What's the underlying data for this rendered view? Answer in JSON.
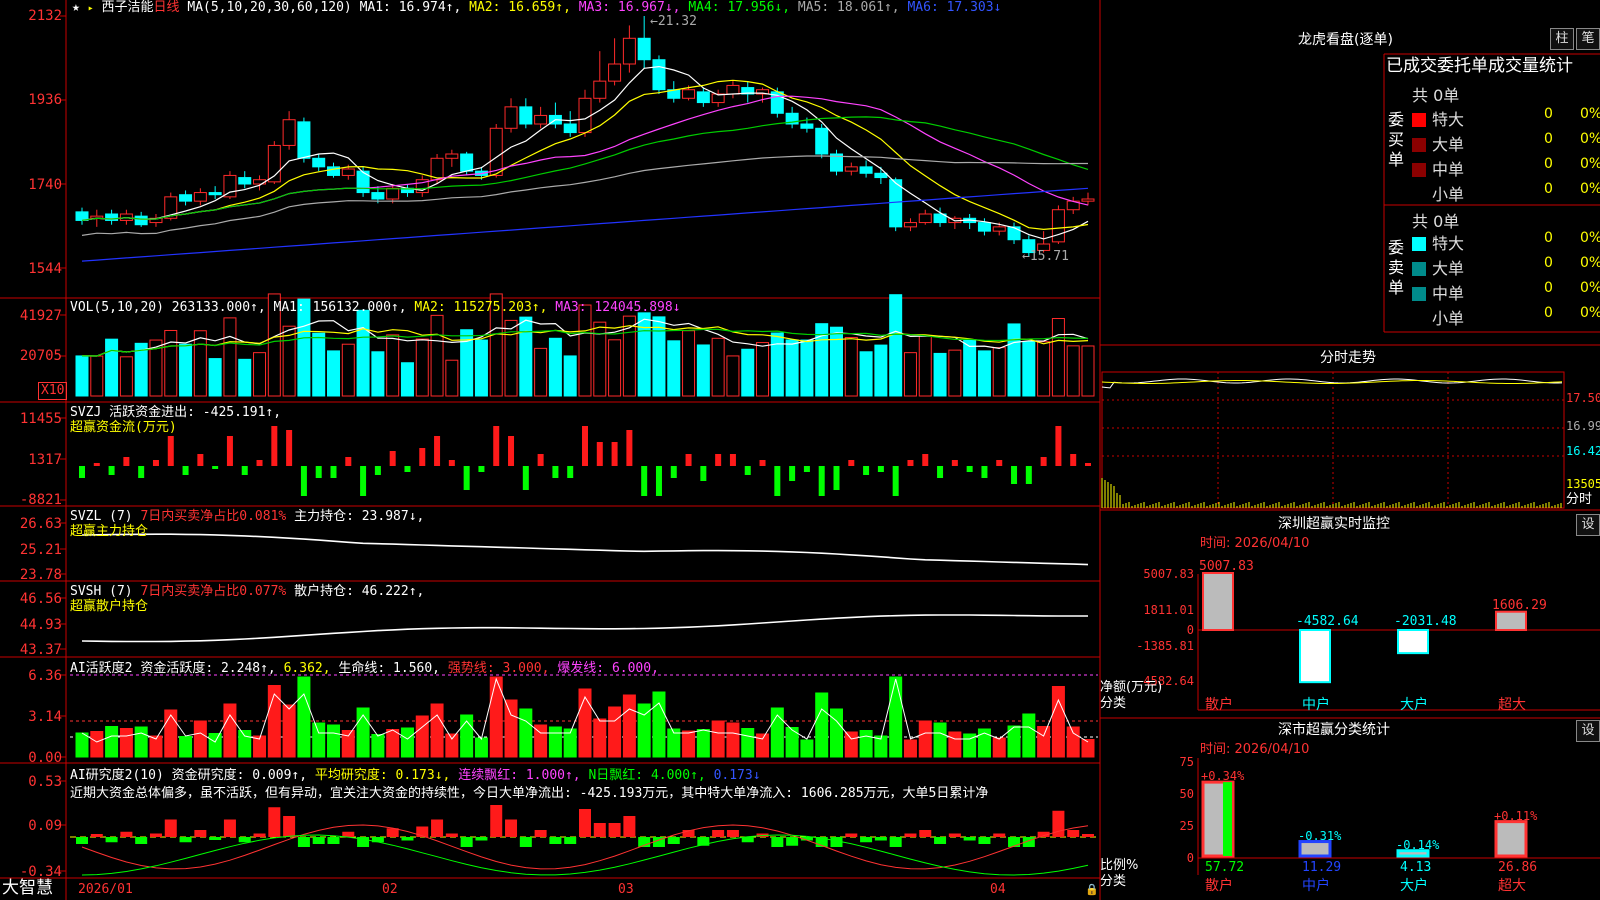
{
  "colors": {
    "up": "#ff2a2a",
    "down": "#00ffff",
    "grid": "#c80000",
    "ma1": "#ffffff",
    "ma2": "#ffff00",
    "ma3": "#ff44ff",
    "ma4": "#00cc00",
    "ma5": "#aaaaaa",
    "ma6": "#2233ff",
    "green_bar": "#00ff00"
  },
  "header": {
    "star_icon": "star-icon",
    "stock_name": "西子洁能",
    "period": "日线",
    "ma_label": "MA(5,10,20,30,60,120)",
    "ma1": "MA1: 16.974↑,",
    "ma2": "MA2: 16.659↑,",
    "ma3": "MA3: 16.967↓,",
    "ma4": "MA4: 17.956↓,",
    "ma5": "MA5: 18.061↑,",
    "ma6": "MA6: 17.303↓"
  },
  "price_axis": [
    "2132",
    "1936",
    "1740",
    "1544"
  ],
  "price_annotations": {
    "high": "21.32",
    "low": "15.71"
  },
  "vol": {
    "label": "VOL(5,10,20)",
    "value": "263133.000↑,",
    "ma1": "MA1: 156132.000↑,",
    "ma2": "MA2: 115275.203↑,",
    "ma3": "MA3: 124045.898↓",
    "axis": [
      "41927",
      "20705"
    ],
    "unit": "X10"
  },
  "svzj": {
    "label": "SVZJ",
    "title": "活跃资金进出: -425.191↑,",
    "subtitle": "超赢资金流(万元)",
    "axis": [
      "11455",
      "1317",
      "-8821"
    ]
  },
  "svzl": {
    "label": "SVZL (7)",
    "title1": "7日内买卖净占比0.081%",
    "title2": "主力持仓: 23.987↓,",
    "subtitle": "超赢主力持仓",
    "axis": [
      "26.63",
      "25.21",
      "23.78"
    ]
  },
  "svsh": {
    "label": "SVSH (7)",
    "title1": "7日内买卖净占比0.077%",
    "title2": "散户持仓: 46.222↑,",
    "subtitle": "超赢散户持仓",
    "axis": [
      "46.56",
      "44.93",
      "43.37"
    ]
  },
  "ai1": {
    "label": "AI活跃度2",
    "t1": "资金活跃度: 2.248↑,",
    "t2": "6.362,",
    "t3": "生命线: 1.560,",
    "t4": "强势线: 3.000,",
    "t5": "爆发线: 6.000,",
    "axis": [
      "6.36",
      "3.14",
      "0.00"
    ]
  },
  "ai2": {
    "label": "AI研究度2(10)",
    "t1": "资金研究度: 0.009↑,",
    "t2": "平均研究度: 0.173↓,",
    "t3": "连续飘红: 1.000↑,",
    "t4": "N日飘红: 4.000↑,",
    "t5": "0.173↓",
    "comment": "近期大资金总体偏多，虽不活跃，但有异动，宜关注大资金的持续性，今日大单净流出: -425.193万元，其中特大单净流入: 1606.285万元，大单5日累计净",
    "axis": [
      "0.53",
      "0.09",
      "-0.34"
    ]
  },
  "dates": [
    "2026/01",
    "02",
    "03",
    "04"
  ],
  "footer_brand": "大智慧",
  "lhb": {
    "title": "龙虎看盘(逐单)",
    "btn1": "柱",
    "btn2": "笔",
    "subtitle": "已成交委托单成交量统计",
    "buy": {
      "side": "委买单",
      "total": "共 0单",
      "rows": [
        {
          "name": "特大",
          "v": "0",
          "p": "0%",
          "c": "#ff0000"
        },
        {
          "name": "大单",
          "v": "0",
          "p": "0%",
          "c": "#8b0000"
        },
        {
          "name": "中单",
          "v": "0",
          "p": "0%",
          "c": "#8b0000"
        },
        {
          "name": "小单",
          "v": "0",
          "p": "0%",
          "c": "#000000"
        }
      ]
    },
    "sell": {
      "side": "委卖单",
      "total": "共 0单",
      "rows": [
        {
          "name": "特大",
          "v": "0",
          "p": "0%",
          "c": "#00ffff"
        },
        {
          "name": "大单",
          "v": "0",
          "p": "0%",
          "c": "#008b8b"
        },
        {
          "name": "中单",
          "v": "0",
          "p": "0%",
          "c": "#008b8b"
        },
        {
          "name": "小单",
          "v": "0",
          "p": "0%",
          "c": "#000000"
        }
      ]
    }
  },
  "intraday": {
    "title": "分时走势",
    "axis": [
      "17.50",
      "16.99",
      "16.42",
      "13505"
    ],
    "unit": "分时"
  },
  "monitor": {
    "title": "深圳超赢实时监控",
    "btn": "设",
    "time": "时间: 2026/04/10",
    "axis": [
      "5007.83",
      "1811.01",
      "0",
      "-1385.81",
      "-4582.64"
    ],
    "y_unit": "净额(万元)",
    "x_unit": "分类",
    "categories": [
      "散户",
      "中户",
      "大户",
      "超大"
    ],
    "values": [
      5007.83,
      -4582.64,
      -2031.48,
      1606.29
    ],
    "value_labels": [
      "5007.83",
      "-4582.64",
      "-2031.48",
      "1606.29"
    ]
  },
  "classify": {
    "title": "深市超赢分类统计",
    "btn": "设",
    "time": "时间: 2026/04/10",
    "axis": [
      "75",
      "50",
      "25",
      "0"
    ],
    "y_unit": "比例%",
    "x_unit": "分类",
    "categories": [
      "散户",
      "中户",
      "大户",
      "超大"
    ],
    "values": [
      57.72,
      11.29,
      4.13,
      26.86
    ],
    "changes": [
      "+0.34%",
      "-0.31%",
      "-0.14%",
      "+0.11%"
    ],
    "value_labels": [
      "57.72",
      "11.29",
      "4.13",
      "26.86"
    ]
  },
  "chart_data": {
    "type": "candlestick",
    "title": "西子洁能 日线",
    "price_ylim": [
      15.44,
      21.32
    ],
    "candles_ohlc": [
      [
        16.75,
        16.55,
        16.85,
        16.45
      ],
      [
        16.6,
        16.65,
        16.8,
        16.4
      ],
      [
        16.7,
        16.55,
        16.8,
        16.45
      ],
      [
        16.55,
        16.7,
        16.8,
        16.45
      ],
      [
        16.65,
        16.45,
        16.75,
        16.4
      ],
      [
        16.5,
        16.6,
        16.7,
        16.4
      ],
      [
        16.6,
        17.1,
        17.2,
        16.55
      ],
      [
        17.15,
        17.0,
        17.25,
        16.9
      ],
      [
        17.0,
        17.2,
        17.3,
        16.9
      ],
      [
        17.2,
        17.15,
        17.35,
        17.05
      ],
      [
        17.1,
        17.6,
        17.7,
        17.05
      ],
      [
        17.55,
        17.4,
        17.7,
        17.3
      ],
      [
        17.4,
        17.5,
        17.6,
        17.25
      ],
      [
        17.45,
        18.3,
        18.4,
        17.4
      ],
      [
        18.3,
        18.9,
        19.1,
        18.2
      ],
      [
        18.85,
        18.0,
        18.95,
        17.9
      ],
      [
        18.0,
        17.8,
        18.1,
        17.7
      ],
      [
        17.8,
        17.6,
        17.9,
        17.55
      ],
      [
        17.6,
        17.75,
        17.85,
        17.5
      ],
      [
        17.7,
        17.2,
        17.8,
        17.1
      ],
      [
        17.2,
        17.05,
        17.35,
        16.95
      ],
      [
        17.05,
        17.3,
        17.4,
        16.95
      ],
      [
        17.3,
        17.2,
        17.4,
        17.1
      ],
      [
        17.2,
        17.5,
        17.6,
        17.1
      ],
      [
        17.5,
        18.0,
        18.1,
        17.4
      ],
      [
        18.0,
        18.1,
        18.2,
        17.8
      ],
      [
        18.1,
        17.7,
        18.15,
        17.6
      ],
      [
        17.7,
        17.6,
        17.8,
        17.5
      ],
      [
        17.6,
        18.7,
        18.8,
        17.55
      ],
      [
        18.7,
        19.2,
        19.4,
        18.6
      ],
      [
        19.2,
        18.8,
        19.4,
        18.7
      ],
      [
        18.8,
        19.0,
        19.2,
        18.7
      ],
      [
        19.0,
        18.8,
        19.3,
        18.7
      ],
      [
        18.8,
        18.6,
        19.1,
        18.5
      ],
      [
        18.6,
        19.4,
        19.6,
        18.5
      ],
      [
        19.4,
        19.8,
        20.5,
        19.3
      ],
      [
        19.8,
        20.2,
        20.8,
        19.7
      ],
      [
        20.2,
        20.8,
        21.1,
        20.0
      ],
      [
        20.8,
        20.3,
        21.32,
        20.1
      ],
      [
        20.3,
        19.6,
        20.4,
        19.5
      ],
      [
        19.6,
        19.4,
        19.8,
        19.3
      ],
      [
        19.4,
        19.6,
        19.7,
        19.35
      ],
      [
        19.55,
        19.3,
        19.65,
        19.2
      ],
      [
        19.3,
        19.5,
        19.6,
        19.2
      ],
      [
        19.5,
        19.7,
        19.8,
        19.4
      ],
      [
        19.65,
        19.5,
        19.8,
        19.3
      ],
      [
        19.5,
        19.6,
        19.65,
        19.3
      ],
      [
        19.55,
        19.05,
        19.65,
        18.95
      ],
      [
        19.05,
        18.8,
        19.2,
        18.7
      ],
      [
        18.8,
        18.7,
        18.95,
        18.6
      ],
      [
        18.7,
        18.1,
        18.8,
        18.0
      ],
      [
        18.1,
        17.7,
        18.2,
        17.6
      ],
      [
        17.7,
        17.8,
        17.9,
        17.6
      ],
      [
        17.8,
        17.65,
        17.95,
        17.55
      ],
      [
        17.65,
        17.55,
        17.8,
        17.4
      ],
      [
        17.5,
        16.4,
        17.55,
        16.3
      ],
      [
        16.4,
        16.5,
        16.6,
        16.3
      ],
      [
        16.5,
        16.7,
        16.8,
        16.45
      ],
      [
        16.7,
        16.5,
        16.85,
        16.4
      ],
      [
        16.5,
        16.6,
        16.65,
        16.35
      ],
      [
        16.6,
        16.5,
        16.7,
        16.35
      ],
      [
        16.5,
        16.3,
        16.6,
        16.2
      ],
      [
        16.3,
        16.4,
        16.5,
        16.2
      ],
      [
        16.4,
        16.1,
        16.5,
        16.0
      ],
      [
        16.1,
        15.8,
        16.2,
        15.71
      ],
      [
        15.85,
        16.0,
        16.3,
        15.8
      ],
      [
        16.05,
        16.8,
        16.9,
        16.0
      ],
      [
        16.8,
        17.0,
        17.1,
        16.7
      ],
      [
        17.0,
        17.05,
        17.2,
        16.9
      ]
    ],
    "volume_ma": [
      "MA1",
      "MA2",
      "MA3"
    ],
    "intraday_price": [
      16.7,
      16.72,
      16.75
    ]
  }
}
